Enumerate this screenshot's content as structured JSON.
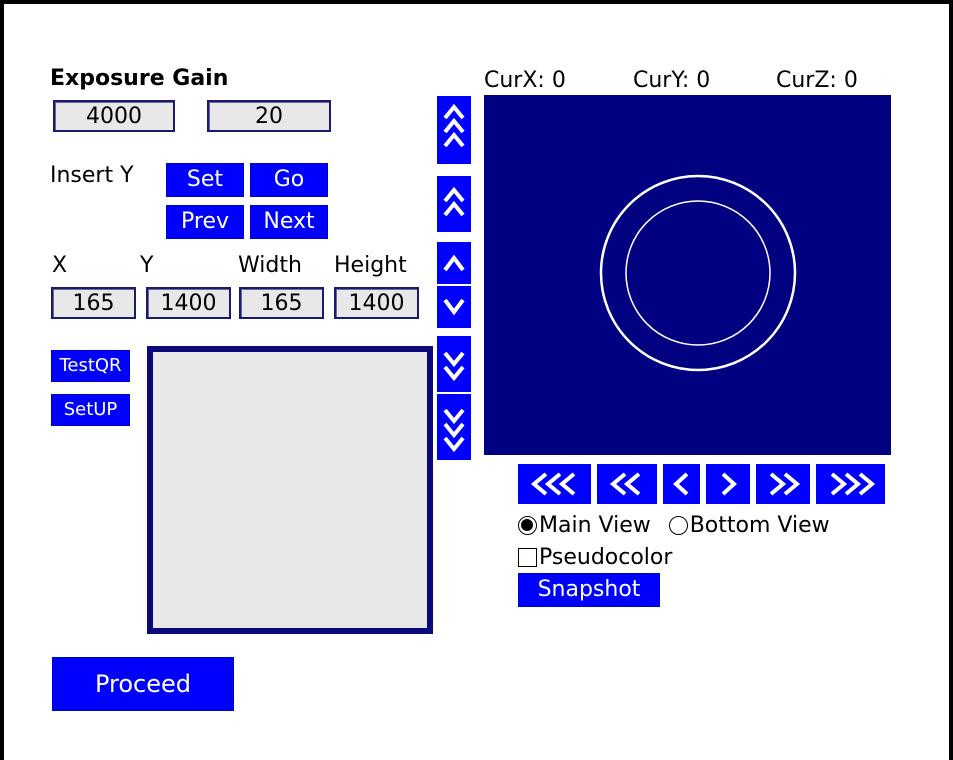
{
  "exposure_gain": {
    "title": "Exposure Gain",
    "exposure_value": "4000",
    "gain_value": "20"
  },
  "insert": {
    "label": "Insert Y",
    "set_label": "Set",
    "go_label": "Go",
    "prev_label": "Prev",
    "next_label": "Next"
  },
  "roi": {
    "x_label": "X",
    "y_label": "Y",
    "width_label": "Width",
    "height_label": "Height",
    "x_value": "165",
    "y_value": "1400",
    "width_value": "165",
    "height_value": "1400"
  },
  "side_buttons": {
    "testqr_label": "TestQR",
    "setup_label": "SetUP"
  },
  "proceed_label": "Proceed",
  "coords": {
    "curx": "CurX: 0",
    "cury": "CurY: 0",
    "curz": "CurZ: 0"
  },
  "view": {
    "main_view_label": "Main View",
    "bottom_view_label": "Bottom View",
    "selected": "Main View",
    "pseudocolor_label": "Pseudocolor",
    "pseudocolor_checked": false,
    "snapshot_label": "Snapshot"
  },
  "icons": {
    "vertical": [
      "triple-up-icon",
      "double-up-icon",
      "up-icon",
      "down-icon",
      "double-down-icon",
      "triple-down-icon"
    ],
    "horizontal": [
      "triple-left-icon",
      "double-left-icon",
      "left-icon",
      "right-icon",
      "double-right-icon",
      "triple-right-icon"
    ]
  },
  "colors": {
    "button": "#0000ff",
    "camera_bg": "#000080",
    "field_bg": "#e8e8e8"
  }
}
